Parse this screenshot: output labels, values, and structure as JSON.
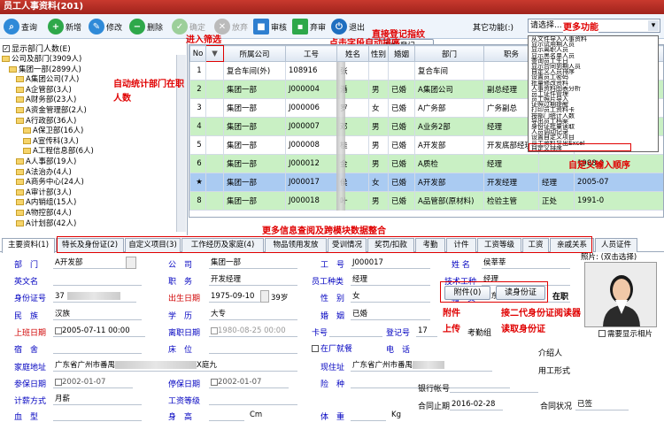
{
  "window": {
    "title": "员工人事资料(201)"
  },
  "toolbar": {
    "query": "查询",
    "add": "新增",
    "edit": "修改",
    "delete": "删除",
    "confirm": "确定",
    "abandon": "放弃",
    "audit": "审核",
    "anti_audit": "弃审",
    "exit": "退出",
    "direct_login": "指纹登记",
    "other_label": "其它功能(:)",
    "other_value": "请选择..."
  },
  "annotations": {
    "fingerprint": "直接登记指纹",
    "more_functions": "更多功能",
    "enter_filter": "进入筛选",
    "click_sort": "点击字段自动排序",
    "auto_count": "自动统计部门在职人数",
    "custom_order": "自定义输入顺序",
    "more_info": "更多信息查阅及跨模块数据整合",
    "attachment": "附件上传",
    "id_read": "接二代身份证阅读器读取身份证"
  },
  "left": {
    "show_dept_count": "显示部门人数(E)",
    "tree": [
      "公司及部门(3909人)",
      "集团一部(2899人)",
      "A集团公司(7人)",
      "A企管部(3人)",
      "A财务部(23人)",
      "A资金管理部(2人)",
      "A行政部(36人)",
      "A保卫部(16人)",
      "A宣传科(3人)",
      "A工程信息部(6人)",
      "A人事部(19人)",
      "A法治办(4人)",
      "A商务中心(24人)",
      "A审计部(3人)",
      "A内销组(15人)",
      "A物控部(4人)",
      "A计划部(42人)"
    ]
  },
  "more_menu": {
    "items": [
      "从文件导入人事资料",
      "显示试用期人员",
      "显示离职人员",
      "显示黑名单人员",
      "查询员工生日",
      "显示合同到期人员",
      "自定义人员排序",
      "设置员工密码",
      "批量修改资料",
      "人事资料图表分析",
      "员工证件管理",
      "员工照片导入",
      "证照过期提醒",
      "打印员工资料卡",
      "按部门统计人数",
      "导出员工档案",
      "身份证批量读取",
      "人员调动记录",
      "设置自定义项目",
      "员工资料导出Excel",
      "自定义排序"
    ]
  },
  "grid": {
    "headers": [
      "No",
      "▼",
      "所属公司",
      "工号",
      "姓名",
      "性别",
      "婚姻",
      "部门",
      "职务",
      "",
      ""
    ],
    "rows": [
      [
        "1",
        "",
        "复合车间(外)",
        "108916",
        "张",
        "",
        "",
        "复合车间",
        "",
        "",
        ""
      ],
      [
        "2",
        "",
        "集团一部",
        "J000004",
        "潘",
        "男",
        "已婚",
        "A集团公司",
        "副总经理",
        "",
        ""
      ],
      [
        "3",
        "",
        "集团一部",
        "J000006",
        "罗",
        "女",
        "已婚",
        "A广务部",
        "广务副总",
        "",
        ""
      ],
      [
        "4",
        "",
        "集团一部",
        "J000007",
        "邓",
        "男",
        "已婚",
        "A业务2部",
        "经理",
        "",
        ""
      ],
      [
        "5",
        "",
        "集团一部",
        "J000008",
        "桂",
        "男",
        "已婚",
        "A开发部",
        "开发底部经理",
        "",
        ""
      ],
      [
        "6",
        "",
        "集团一部",
        "J000012",
        "金",
        "男",
        "已婚",
        "A质检",
        "经理",
        "",
        "1988-0"
      ],
      [
        "★",
        "",
        "集团一部",
        "J000017",
        "侯",
        "女",
        "已婚",
        "A开发部",
        "开发经理",
        "经理",
        "2005-07"
      ],
      [
        "8",
        "",
        "集团一部",
        "J000018",
        "叶",
        "男",
        "已婚",
        "A品管部(原材料)",
        "检验主管",
        "正处",
        "1991-0"
      ]
    ]
  },
  "tabs": [
    "主要资料(1)",
    "特长及身份证(2)",
    "自定义项目(3)",
    "工作经历及家庭(4)",
    "物品领用发放",
    "受训情况",
    "奖罚/扣款",
    "考勤",
    "计件",
    "工资等级",
    "工资",
    "亲戚关系",
    "人员证件"
  ],
  "form": {
    "dept_label": "部　门",
    "dept_value": "A开发部",
    "company_label": "公　司",
    "company_value": "集团一部",
    "empno_label": "工　号",
    "empno_value": "J000017",
    "name_label": "姓 名",
    "name_value": "侯莘莘",
    "eng_label": "英文名",
    "eng_value": "",
    "post_label": "职　务",
    "post_value": "开发经理",
    "emptype_label": "员工种类",
    "emptype_value": "经理",
    "tech_label": "技术工种",
    "tech_value": "经理",
    "idcard_label": "身份证号",
    "idcard_value": "37",
    "birthday_label": "出生日期",
    "birthday_value": "1975-09-10",
    "age_value": "39岁",
    "sex_label": "性　别",
    "sex_value": "女",
    "native_label": "籍　贯",
    "native_value": "广东",
    "nation_label": "民　族",
    "nation_value": "汉族",
    "edu_label": "学　历",
    "edu_value": "大专",
    "marry_label": "婚　姻",
    "marry_value": "已婚",
    "attach_btn": "附件(0)",
    "idread_btn": "读身份证",
    "status_value": "在职",
    "photo_label": "照片: (双击选择)",
    "onboard_label": "上班日期",
    "onboard_value": "2005-07-11 00:00",
    "leave_label": "离职日期",
    "leave_value": "1980-08-25 00:00",
    "card_label": "卡号",
    "login_label": "登记号",
    "login_value": "17",
    "attend_label": "考勤组",
    "dorm_label": "宿　舍",
    "bed_label": "床　位",
    "meal_label": "在厂就餐",
    "phone_label": "电　话",
    "photo_print": "需要显示相片",
    "addr_label": "家庭地址",
    "addr_value": "广东省广州市番禺",
    "addr_tail": "X庭九",
    "cur_label": "现住址",
    "cur_value": "广东省广州市番禺",
    "intro_label": "介绍人",
    "ins_label": "参保日期",
    "ins_value": "2002-01-07",
    "stopins_label": "停保日期",
    "stopins_value": "2002-01-07",
    "risk_label": "险　种",
    "form_label": "用工形式",
    "wage_label": "计薪方式",
    "wage_value": "月薪",
    "wlevel_label": "工资等级",
    "bank_label": "银行帐号",
    "blood_label": "血　型",
    "height_label": "身　高",
    "height_unit": "Cm",
    "weight_label": "体　重",
    "weight_unit": "Kg",
    "contract_label": "合同止期",
    "contract_value": "2016-02-28",
    "contract_status_label": "合同状况",
    "contract_status_value": "已签"
  }
}
